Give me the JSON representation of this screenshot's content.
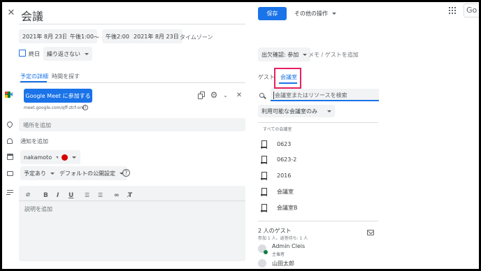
{
  "header": {
    "title": "会議",
    "save_label": "保存",
    "more_actions_label": "その他の操作",
    "brand_fragment": "Go"
  },
  "datetime": {
    "start_date": "2021年 8月 23日",
    "start_time": "午後1:00",
    "separator": "〜",
    "end_time": "午後2:00",
    "end_date": "2021年 8月 23日",
    "timezone_label": "タイムゾーン"
  },
  "allday": {
    "checkbox_label": "終日",
    "repeat_value": "繰り返さない"
  },
  "tabs": {
    "details": "予定の詳細",
    "find_time": "時間を探す"
  },
  "meet": {
    "join_label": "Google Meet に参加する",
    "link_text": "meet.google.com/qff-ztrf-ord"
  },
  "fields": {
    "location_placeholder": "場所を追加",
    "notification_label": "通知を追加",
    "calendar_owner": "nakamoto",
    "calendar_color": "#d50000",
    "availability": "予定あり",
    "visibility": "デフォルトの公開設定",
    "description_placeholder": "説明を追加"
  },
  "rsvp": {
    "status_label": "出欠確認: 参加",
    "note_label": "メモ / ゲストを追加"
  },
  "right_tabs": {
    "guests": "ゲスト",
    "rooms": "会議室"
  },
  "rooms": {
    "search_placeholder": "会議室またはリソースを検索",
    "filter_value": "利用可能な会議室のみ",
    "section_label": "すべての会議室",
    "items": [
      "0623",
      "0623-2",
      "2016",
      "会議室",
      "会議室B"
    ]
  },
  "guests": {
    "heading": "2 人のゲスト",
    "summary": "参加 1 人、返答待ち: 1 人",
    "list": [
      {
        "name": "Admin Cleis",
        "role": "主催者"
      },
      {
        "name": "山田太郎",
        "role": ""
      }
    ]
  },
  "colors": {
    "accent": "#1a73e8",
    "highlight_box": "#e91e63"
  }
}
